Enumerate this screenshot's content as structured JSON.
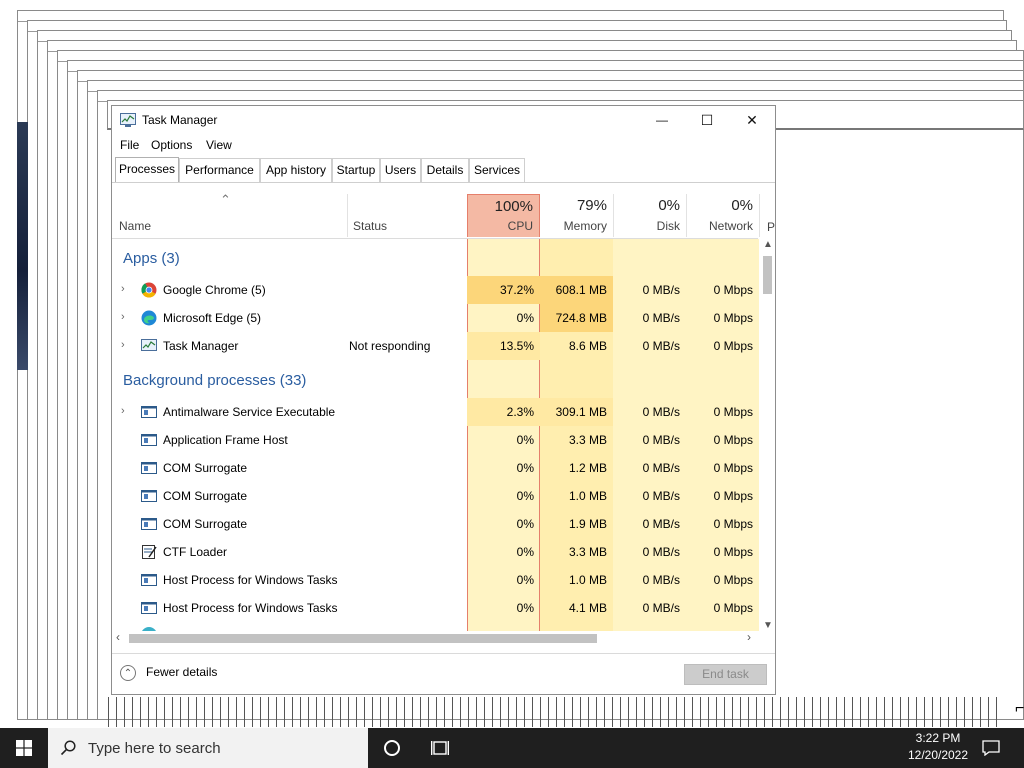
{
  "window": {
    "title": "Task Manager",
    "controls": {
      "minimize": "—",
      "maximize": "☐",
      "close": "✕"
    }
  },
  "menu": [
    "File",
    "Options",
    "View"
  ],
  "tabs": [
    "Processes",
    "Performance",
    "App history",
    "Startup",
    "Users",
    "Details",
    "Services"
  ],
  "active_tab": "Processes",
  "columns": {
    "name": "Name",
    "status": "Status",
    "cpu": {
      "pct": "100%",
      "label": "CPU"
    },
    "memory": {
      "pct": "79%",
      "label": "Memory"
    },
    "disk": {
      "pct": "0%",
      "label": "Disk"
    },
    "network": {
      "pct": "0%",
      "label": "Network"
    },
    "power_partial": "P"
  },
  "groups": {
    "apps": "Apps (3)",
    "background": "Background processes (33)"
  },
  "apps": [
    {
      "name": "Google Chrome (5)",
      "status": "",
      "cpu": "37.2%",
      "memory": "608.1 MB",
      "disk": "0 MB/s",
      "network": "0 Mbps",
      "icon": "chrome-icon"
    },
    {
      "name": "Microsoft Edge (5)",
      "status": "",
      "cpu": "0%",
      "memory": "724.8 MB",
      "disk": "0 MB/s",
      "network": "0 Mbps",
      "icon": "edge-icon"
    },
    {
      "name": "Task Manager",
      "status": "Not responding",
      "cpu": "13.5%",
      "memory": "8.6 MB",
      "disk": "0 MB/s",
      "network": "0 Mbps",
      "icon": "task-manager-icon"
    }
  ],
  "background": [
    {
      "name": "Antimalware Service Executable",
      "cpu": "2.3%",
      "memory": "309.1 MB",
      "disk": "0 MB/s",
      "network": "0 Mbps",
      "expandable": true
    },
    {
      "name": "Application Frame Host",
      "cpu": "0%",
      "memory": "3.3 MB",
      "disk": "0 MB/s",
      "network": "0 Mbps"
    },
    {
      "name": "COM Surrogate",
      "cpu": "0%",
      "memory": "1.2 MB",
      "disk": "0 MB/s",
      "network": "0 Mbps"
    },
    {
      "name": "COM Surrogate",
      "cpu": "0%",
      "memory": "1.0 MB",
      "disk": "0 MB/s",
      "network": "0 Mbps"
    },
    {
      "name": "COM Surrogate",
      "cpu": "0%",
      "memory": "1.9 MB",
      "disk": "0 MB/s",
      "network": "0 Mbps"
    },
    {
      "name": "CTF Loader",
      "cpu": "0%",
      "memory": "3.3 MB",
      "disk": "0 MB/s",
      "network": "0 Mbps"
    },
    {
      "name": "Host Process for Windows Tasks",
      "cpu": "0%",
      "memory": "1.0 MB",
      "disk": "0 MB/s",
      "network": "0 Mbps"
    },
    {
      "name": "Host Process for Windows Tasks",
      "cpu": "0%",
      "memory": "4.1 MB",
      "disk": "0 MB/s",
      "network": "0 Mbps"
    }
  ],
  "footer": {
    "fewer_details": "Fewer details",
    "end_task": "End task"
  },
  "taskbar": {
    "search_placeholder": "Type here to search",
    "time": "3:22 PM",
    "date": "12/20/2022"
  },
  "colors": {
    "cpu_header": "#f4b9a4",
    "heat_light": "#fff4c4",
    "heat_mid": "#ffe9a3",
    "heat_strong": "#fcd67a",
    "group_text": "#2a5da0",
    "cpu_border": "#e57f6b"
  }
}
